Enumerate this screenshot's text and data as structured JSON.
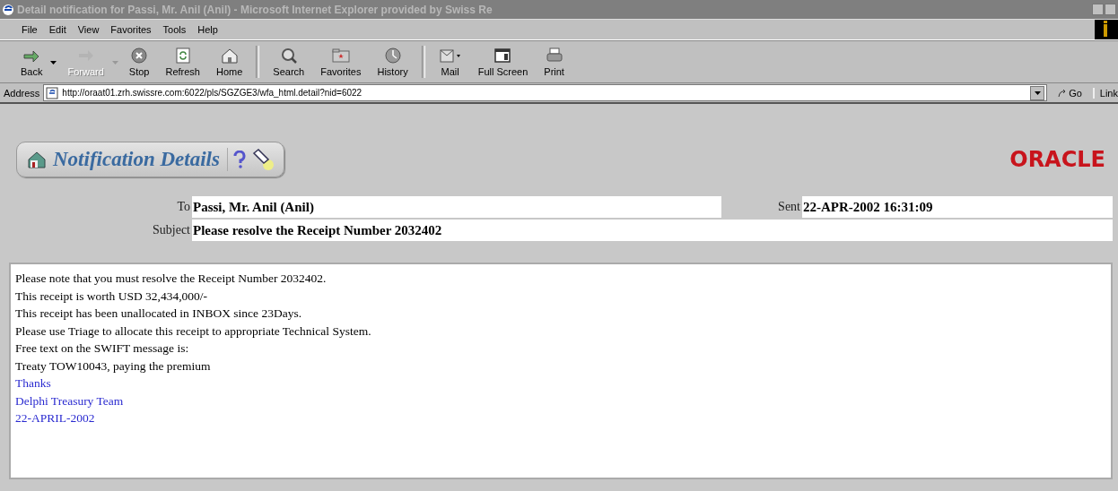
{
  "window": {
    "title": "Detail notification for Passi, Mr. Anil (Anil) - Microsoft Internet Explorer provided by Swiss Re"
  },
  "menu": [
    "File",
    "Edit",
    "View",
    "Favorites",
    "Tools",
    "Help"
  ],
  "toolbar": [
    {
      "kind": "back",
      "label": "Back",
      "disabled": false
    },
    {
      "kind": "forward",
      "label": "Forward",
      "disabled": true
    },
    {
      "kind": "stop",
      "label": "Stop",
      "disabled": false
    },
    {
      "kind": "refresh",
      "label": "Refresh",
      "disabled": false
    },
    {
      "kind": "home",
      "label": "Home",
      "disabled": false
    },
    {
      "kind": "search",
      "label": "Search",
      "disabled": false
    },
    {
      "kind": "favorites",
      "label": "Favorites",
      "disabled": false
    },
    {
      "kind": "history",
      "label": "History",
      "disabled": false
    },
    {
      "kind": "mail",
      "label": "Mail",
      "disabled": false
    },
    {
      "kind": "fullscreen",
      "label": "Full Screen",
      "disabled": false
    },
    {
      "kind": "print",
      "label": "Print",
      "disabled": false
    }
  ],
  "address": {
    "label": "Address",
    "value": "http://oraat01.zrh.swissre.com:6022/pls/SGZGE3/wfa_html.detail?nid=6022",
    "go": "Go",
    "links": "Link"
  },
  "page": {
    "title": "Notification Details",
    "logo": "ORACLE",
    "fields": [
      {
        "label": "To",
        "value": "Passi, Mr. Anil (Anil)"
      },
      {
        "label": "Sent",
        "value": "22-APR-2002 16:31:09"
      },
      {
        "label": "Subject",
        "value": "Please resolve the Receipt Number 2032402"
      }
    ],
    "body": [
      "Please note that you must resolve the Receipt Number 2032402.",
      "This receipt is worth USD 32,434,000/-",
      "This receipt has been unallocated in INBOX since 23Days.",
      "Please use Triage to allocate this receipt to appropriate Technical System.",
      "Free text on the SWIFT message is:",
      "Treaty TOW10043, paying the premium"
    ],
    "signature": [
      "Thanks",
      "Delphi Treasury Team",
      "22-APRIL-2002"
    ]
  }
}
